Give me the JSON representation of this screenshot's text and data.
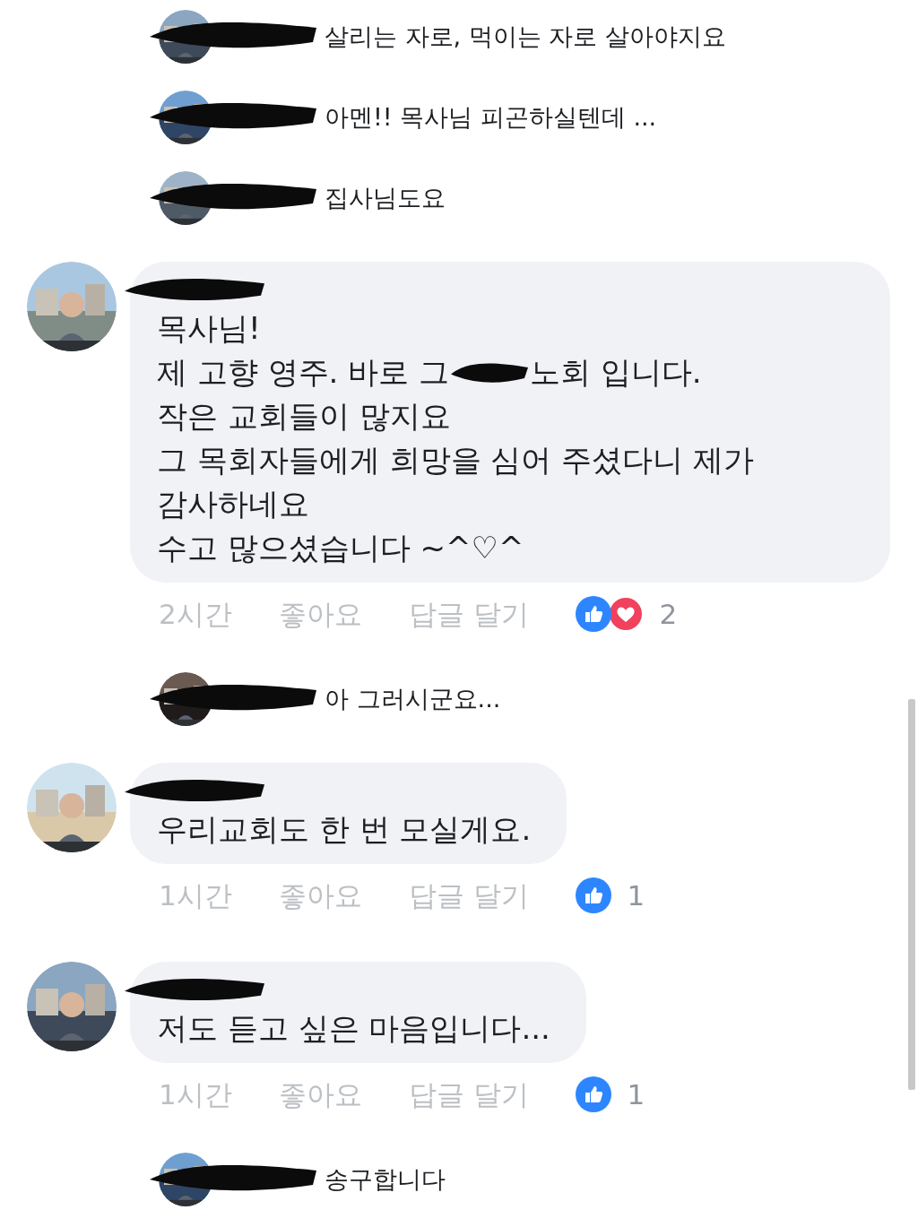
{
  "thread": [
    {
      "kind": "reply",
      "text": "살리는 자로, 먹이는 자로 살아야지요"
    },
    {
      "kind": "reply",
      "text": "아멘!! 목사님 피곤하실텐데 ..."
    },
    {
      "kind": "reply",
      "text": "집사님도요"
    },
    {
      "kind": "comment",
      "paragraphs": [
        [
          "목사님!"
        ],
        [
          "제 고향 영주. 바로 그",
          "노회 입니다."
        ],
        [
          "작은 교회들이 많지요"
        ],
        [
          "그 목회자들에게 희망을 심어 주셨다니 제가 감사하네요"
        ],
        [
          "수고 많으셨습니다 ~^♡^"
        ]
      ],
      "time": "2시간",
      "like": "좋아요",
      "reply": "답글 달기",
      "reactions": [
        {
          "kind": "like"
        },
        {
          "kind": "love"
        }
      ],
      "count": "2"
    },
    {
      "kind": "reply",
      "text": "아 그러시군요..."
    },
    {
      "kind": "comment",
      "paragraphs": [
        [
          "우리교회도 한 번 모실게요."
        ]
      ],
      "time": "1시간",
      "like": "좋아요",
      "reply": "답글 달기",
      "reactions": [
        {
          "kind": "like"
        }
      ],
      "count": "1"
    },
    {
      "kind": "comment",
      "paragraphs": [
        [
          "저도 듣고 싶은 마음입니다..."
        ]
      ],
      "time": "1시간",
      "like": "좋아요",
      "reply": "답글 달기",
      "reactions": [
        {
          "kind": "like"
        }
      ],
      "count": "1"
    },
    {
      "kind": "reply",
      "text": "송구합니다"
    }
  ]
}
